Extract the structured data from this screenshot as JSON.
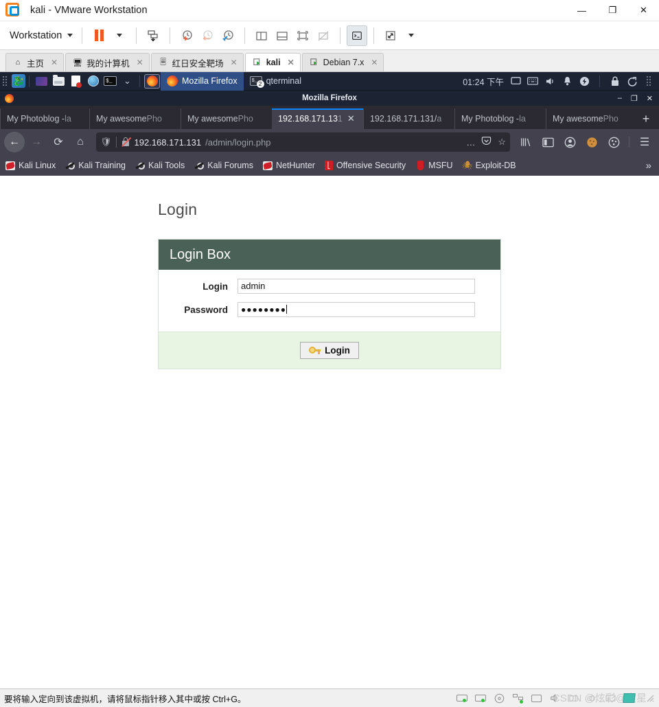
{
  "vmware": {
    "title": "kali - VMware Workstation",
    "window_buttons": {
      "minimize": "—",
      "restore": "❐",
      "close": "✕"
    },
    "toolbar": {
      "menu_label": "Workstation",
      "buttons": [
        {
          "name": "pause-vm",
          "label": "Pause"
        },
        {
          "name": "send-ctrl-alt-del",
          "label": "Send Ctrl+Alt+Del"
        },
        {
          "name": "take-snapshot",
          "label": "Take snapshot"
        },
        {
          "name": "revert-snapshot",
          "label": "Revert to snapshot"
        },
        {
          "name": "manage-snapshots",
          "label": "Manage snapshots"
        },
        {
          "name": "show-sidebar",
          "label": "Show library"
        },
        {
          "name": "show-thumbnails",
          "label": "Show thumbnail bar"
        },
        {
          "name": "show-console",
          "label": "Show console view"
        },
        {
          "name": "hide-console",
          "label": "Hide console view"
        },
        {
          "name": "unity-mode",
          "label": "Unity mode"
        },
        {
          "name": "fullscreen",
          "label": "Enter full screen"
        }
      ]
    },
    "tabs": [
      {
        "label": "主页",
        "icon": "home-icon",
        "active": false
      },
      {
        "label": "我的计算机",
        "icon": "computer-icon",
        "active": false
      },
      {
        "label": "红日安全靶场",
        "icon": "folder-icon",
        "active": false
      },
      {
        "label": "kali",
        "icon": "vm-running-icon",
        "active": true
      },
      {
        "label": "Debian 7.x",
        "icon": "vm-running-icon",
        "active": false
      }
    ],
    "statusbar": {
      "message": "要将输入定向到该虚拟机，请将鼠标指针移入其中或按 Ctrl+G。",
      "watermark": "CSDN @炫彩@文星",
      "devices": [
        "hard-disk",
        "hard-disk-2",
        "cd-drive",
        "network-adapter",
        "printer",
        "sound-card",
        "usb-controller",
        "camera",
        "display",
        "vm-icon"
      ]
    }
  },
  "kali": {
    "taskbar": {
      "launchers": [
        "kali-dragon-menu",
        "show-desktop",
        "file-manager",
        "text-editor",
        "web-browser",
        "terminal",
        "app-chevron"
      ],
      "pinned": [
        "firefox-launcher"
      ],
      "windows": [
        {
          "label": "Mozilla Firefox",
          "icon": "firefox-icon",
          "active": true
        },
        {
          "label": "qterminal",
          "icon": "terminal-icon",
          "badge": "2",
          "active": false
        }
      ],
      "clock": "01:24 下午",
      "tray_icons": [
        "display-icon",
        "keyboard-icon",
        "volume-icon",
        "notification-bell-icon",
        "power-icon",
        "lock-icon",
        "logout-icon",
        "grip-icon"
      ]
    }
  },
  "firefox": {
    "window_title": "Mozilla Firefox",
    "window_buttons": {
      "minimize": "–",
      "maximize": "❐",
      "close": "✕"
    },
    "tabs": [
      {
        "title": "My Photoblog - ",
        "subtitle": "la",
        "active": false
      },
      {
        "title": "My awesome ",
        "subtitle": "Pho",
        "active": false
      },
      {
        "title": "My awesome ",
        "subtitle": "Pho",
        "active": false
      },
      {
        "title": "192.168.171.13",
        "subtitle": "1",
        "active": true
      },
      {
        "title": "192.168.171.131/",
        "subtitle": "a",
        "active": false
      },
      {
        "title": "My Photoblog - ",
        "subtitle": "la",
        "active": false
      },
      {
        "title": "My awesome ",
        "subtitle": "Pho",
        "active": false
      }
    ],
    "new_tab_label": "+",
    "nav": {
      "back": "←",
      "forward": "→",
      "reload": "⟳",
      "home": "⌂",
      "url_host": "192.168.171.131",
      "url_path": "/admin/login.php",
      "ellipsis": "…",
      "pocket": "pocket-icon",
      "bookmark_star": "☆",
      "library": "library-icon",
      "sidebar": "sidebar-icon",
      "account": "account-icon",
      "cookie": "cookie-icon",
      "containers": "containers-icon",
      "menu": "☰"
    },
    "bookmarks": [
      {
        "label": "Kali Linux",
        "icon": "kali-dragon-icon"
      },
      {
        "label": "Kali Training",
        "icon": "wrench-icon"
      },
      {
        "label": "Kali Tools",
        "icon": "wrench-icon"
      },
      {
        "label": "Kali Forums",
        "icon": "wrench-icon"
      },
      {
        "label": "NetHunter",
        "icon": "kali-dragon-icon"
      },
      {
        "label": "Offensive Security",
        "icon": "offsec-icon"
      },
      {
        "label": "MSFU",
        "icon": "metasploit-icon"
      },
      {
        "label": "Exploit-DB",
        "icon": "spider-icon"
      }
    ],
    "bookmarks_overflow": "»"
  },
  "page": {
    "heading": "Login",
    "panel_title": "Login Box",
    "fields": [
      {
        "label": "Login",
        "value": "admin",
        "type": "text"
      },
      {
        "label": "Password",
        "value": "●●●●●●●●",
        "type": "password"
      }
    ],
    "submit_label": "Login",
    "submit_icon": "key-icon",
    "colors": {
      "panel_header_bg": "#4a6157",
      "footer_bg": "#e8f5e3",
      "heading_color": "#4a4a4a"
    }
  }
}
